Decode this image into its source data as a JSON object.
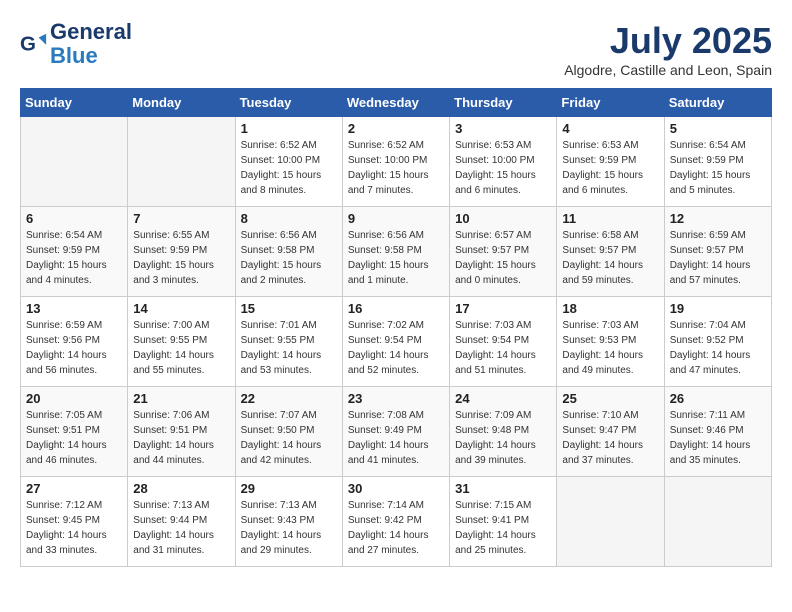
{
  "logo": {
    "line1": "General",
    "line2": "Blue"
  },
  "title": "July 2025",
  "location": "Algodre, Castille and Leon, Spain",
  "weekdays": [
    "Sunday",
    "Monday",
    "Tuesday",
    "Wednesday",
    "Thursday",
    "Friday",
    "Saturday"
  ],
  "weeks": [
    [
      {
        "day": "",
        "info": ""
      },
      {
        "day": "",
        "info": ""
      },
      {
        "day": "1",
        "sunrise": "6:52 AM",
        "sunset": "10:00 PM",
        "daylight": "15 hours and 8 minutes."
      },
      {
        "day": "2",
        "sunrise": "6:52 AM",
        "sunset": "10:00 PM",
        "daylight": "15 hours and 7 minutes."
      },
      {
        "day": "3",
        "sunrise": "6:53 AM",
        "sunset": "10:00 PM",
        "daylight": "15 hours and 6 minutes."
      },
      {
        "day": "4",
        "sunrise": "6:53 AM",
        "sunset": "9:59 PM",
        "daylight": "15 hours and 6 minutes."
      },
      {
        "day": "5",
        "sunrise": "6:54 AM",
        "sunset": "9:59 PM",
        "daylight": "15 hours and 5 minutes."
      }
    ],
    [
      {
        "day": "6",
        "sunrise": "6:54 AM",
        "sunset": "9:59 PM",
        "daylight": "15 hours and 4 minutes."
      },
      {
        "day": "7",
        "sunrise": "6:55 AM",
        "sunset": "9:59 PM",
        "daylight": "15 hours and 3 minutes."
      },
      {
        "day": "8",
        "sunrise": "6:56 AM",
        "sunset": "9:58 PM",
        "daylight": "15 hours and 2 minutes."
      },
      {
        "day": "9",
        "sunrise": "6:56 AM",
        "sunset": "9:58 PM",
        "daylight": "15 hours and 1 minute."
      },
      {
        "day": "10",
        "sunrise": "6:57 AM",
        "sunset": "9:57 PM",
        "daylight": "15 hours and 0 minutes."
      },
      {
        "day": "11",
        "sunrise": "6:58 AM",
        "sunset": "9:57 PM",
        "daylight": "14 hours and 59 minutes."
      },
      {
        "day": "12",
        "sunrise": "6:59 AM",
        "sunset": "9:57 PM",
        "daylight": "14 hours and 57 minutes."
      }
    ],
    [
      {
        "day": "13",
        "sunrise": "6:59 AM",
        "sunset": "9:56 PM",
        "daylight": "14 hours and 56 minutes."
      },
      {
        "day": "14",
        "sunrise": "7:00 AM",
        "sunset": "9:55 PM",
        "daylight": "14 hours and 55 minutes."
      },
      {
        "day": "15",
        "sunrise": "7:01 AM",
        "sunset": "9:55 PM",
        "daylight": "14 hours and 53 minutes."
      },
      {
        "day": "16",
        "sunrise": "7:02 AM",
        "sunset": "9:54 PM",
        "daylight": "14 hours and 52 minutes."
      },
      {
        "day": "17",
        "sunrise": "7:03 AM",
        "sunset": "9:54 PM",
        "daylight": "14 hours and 51 minutes."
      },
      {
        "day": "18",
        "sunrise": "7:03 AM",
        "sunset": "9:53 PM",
        "daylight": "14 hours and 49 minutes."
      },
      {
        "day": "19",
        "sunrise": "7:04 AM",
        "sunset": "9:52 PM",
        "daylight": "14 hours and 47 minutes."
      }
    ],
    [
      {
        "day": "20",
        "sunrise": "7:05 AM",
        "sunset": "9:51 PM",
        "daylight": "14 hours and 46 minutes."
      },
      {
        "day": "21",
        "sunrise": "7:06 AM",
        "sunset": "9:51 PM",
        "daylight": "14 hours and 44 minutes."
      },
      {
        "day": "22",
        "sunrise": "7:07 AM",
        "sunset": "9:50 PM",
        "daylight": "14 hours and 42 minutes."
      },
      {
        "day": "23",
        "sunrise": "7:08 AM",
        "sunset": "9:49 PM",
        "daylight": "14 hours and 41 minutes."
      },
      {
        "day": "24",
        "sunrise": "7:09 AM",
        "sunset": "9:48 PM",
        "daylight": "14 hours and 39 minutes."
      },
      {
        "day": "25",
        "sunrise": "7:10 AM",
        "sunset": "9:47 PM",
        "daylight": "14 hours and 37 minutes."
      },
      {
        "day": "26",
        "sunrise": "7:11 AM",
        "sunset": "9:46 PM",
        "daylight": "14 hours and 35 minutes."
      }
    ],
    [
      {
        "day": "27",
        "sunrise": "7:12 AM",
        "sunset": "9:45 PM",
        "daylight": "14 hours and 33 minutes."
      },
      {
        "day": "28",
        "sunrise": "7:13 AM",
        "sunset": "9:44 PM",
        "daylight": "14 hours and 31 minutes."
      },
      {
        "day": "29",
        "sunrise": "7:13 AM",
        "sunset": "9:43 PM",
        "daylight": "14 hours and 29 minutes."
      },
      {
        "day": "30",
        "sunrise": "7:14 AM",
        "sunset": "9:42 PM",
        "daylight": "14 hours and 27 minutes."
      },
      {
        "day": "31",
        "sunrise": "7:15 AM",
        "sunset": "9:41 PM",
        "daylight": "14 hours and 25 minutes."
      },
      {
        "day": "",
        "info": ""
      },
      {
        "day": "",
        "info": ""
      }
    ]
  ]
}
